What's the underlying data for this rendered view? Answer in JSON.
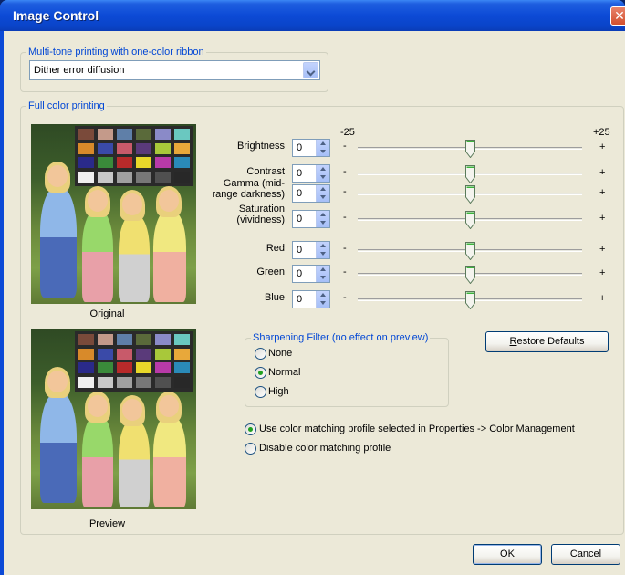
{
  "window": {
    "title": "Image Control",
    "close_glyph": "✕"
  },
  "multitone": {
    "legend": "Multi-tone printing with one-color ribbon",
    "selected": "Dither error diffusion"
  },
  "fullcolor": {
    "legend": "Full color printing",
    "scale_min": "-25",
    "scale_max": "+25",
    "minus": "-",
    "plus": "+",
    "sliders": [
      {
        "label": "Brightness",
        "value": "0",
        "level": 0
      },
      {
        "label": "Contrast",
        "value": "0",
        "level": 0
      },
      {
        "label": "Gamma (mid-range darkness)",
        "value": "0",
        "level": 0
      },
      {
        "label": "Saturation (vividness)",
        "value": "0",
        "level": 0
      },
      {
        "label": "Red",
        "value": "0",
        "level": 0
      },
      {
        "label": "Green",
        "value": "0",
        "level": 0
      },
      {
        "label": "Blue",
        "value": "0",
        "level": 0
      }
    ],
    "original_caption": "Original",
    "preview_caption": "Preview"
  },
  "sharpening": {
    "legend": "Sharpening Filter (no effect on preview)",
    "options": [
      "None",
      "Normal",
      "High"
    ],
    "selected": "Normal"
  },
  "restore_defaults": {
    "label_pre": "",
    "label_mnemonic": "R",
    "label_rest": "estore Defaults"
  },
  "color_matching": {
    "options": [
      "Use color matching profile selected in Properties -> Color Management",
      "Disable color matching profile"
    ],
    "selected_index": 0
  },
  "buttons": {
    "ok": "OK",
    "cancel": "Cancel"
  },
  "colors": {
    "accent": "#0046d5",
    "title_bar": "#0c4ad6",
    "dialog_bg": "#ece9d8",
    "radio_dot": "#21a121"
  }
}
